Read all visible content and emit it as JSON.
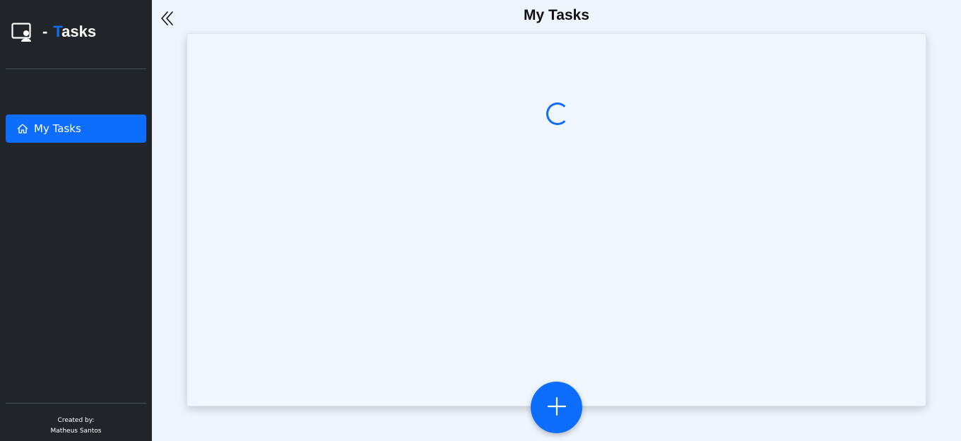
{
  "sidebar": {
    "brand": {
      "icon": "person-video-icon",
      "separator": "-",
      "title_first_letter": "T",
      "title_rest": "asks"
    },
    "nav": [
      {
        "label": "My Tasks",
        "icon": "house-icon",
        "active": true
      }
    ],
    "footer": {
      "line1": "Created by:",
      "line2": "Matheus Santos"
    }
  },
  "header": {
    "collapse_icon": "chevron-double-left-icon",
    "title": "My Tasks"
  },
  "main": {
    "loading": true,
    "add_button_icon": "plus-icon"
  },
  "colors": {
    "sidebar_bg": "#212529",
    "accent": "#0d6efd",
    "page_bg": "#eff5fd"
  }
}
